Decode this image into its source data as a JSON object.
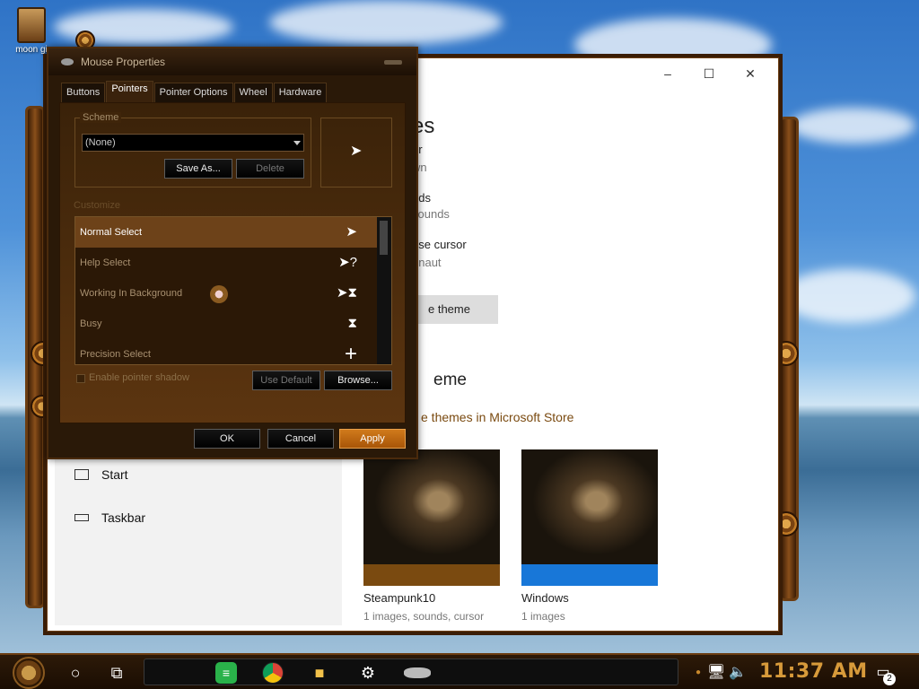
{
  "desktop": {
    "icon_label": "moon gi"
  },
  "settings": {
    "partial_lines": [
      "es",
      "or",
      "wn",
      "nds",
      "sounds",
      "use cursor",
      "onaut",
      "e theme"
    ],
    "get_more_heading": "eme",
    "get_more_link": "e themes in Microsoft Store",
    "nav": [
      {
        "label": "Start",
        "icon": "start-icon"
      },
      {
        "label": "Taskbar",
        "icon": "taskbar-icon"
      }
    ],
    "themes": [
      {
        "name": "Steampunk10",
        "desc": "1 images, sounds, cursor",
        "accent": "#7a4a10"
      },
      {
        "name": "Windows",
        "desc": "1 images",
        "accent": "#1877d8"
      }
    ],
    "window_controls": {
      "minimize": "–",
      "maximize": "☐",
      "close": "✕"
    }
  },
  "mouse": {
    "title": "Mouse Properties",
    "tabs": [
      "Buttons",
      "Pointers",
      "Pointer Options",
      "Wheel",
      "Hardware"
    ],
    "active_tab": "Pointers",
    "scheme_label": "Scheme",
    "scheme_value": "(None)",
    "save_as": "Save As...",
    "delete": "Delete",
    "customize_label": "Customize",
    "rows": [
      {
        "label": "Normal Select",
        "glyph": "➤"
      },
      {
        "label": "Help Select",
        "glyph": "➤?"
      },
      {
        "label": "Working In Background",
        "glyph": "➤⧗"
      },
      {
        "label": "Busy",
        "glyph": "⧗"
      },
      {
        "label": "Precision Select",
        "glyph": "+"
      }
    ],
    "enable_shadow": "Enable pointer shadow",
    "use_default": "Use Default",
    "browse": "Browse...",
    "ok": "OK",
    "cancel": "Cancel",
    "apply": "Apply"
  },
  "taskbar": {
    "clock": "11:37 AM",
    "notification_count": "2"
  }
}
